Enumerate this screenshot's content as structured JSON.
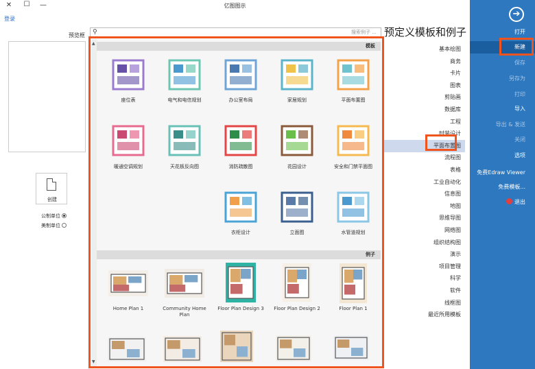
{
  "window": {
    "title": "亿图图示",
    "close": "✕",
    "minimize": "—",
    "maximize": "☐",
    "login": "登录"
  },
  "menu": {
    "back": "➔",
    "items": [
      {
        "label": "打开",
        "state": "normal"
      },
      {
        "label": "新建",
        "state": "selected"
      },
      {
        "label": "保存",
        "state": "dim"
      },
      {
        "label": "另存为",
        "state": "dim"
      },
      {
        "label": "打印",
        "state": "dim"
      },
      {
        "label": "导入",
        "state": "normal"
      },
      {
        "label": "导出 & 发送",
        "state": "dim"
      },
      {
        "label": "关闭",
        "state": "dim"
      },
      {
        "label": "选项",
        "state": "normal"
      },
      {
        "label": "免费Edraw Viewer",
        "state": "normal"
      },
      {
        "label": "免费模板...",
        "state": "normal"
      },
      {
        "label": "退出",
        "state": "normal"
      }
    ]
  },
  "categories": {
    "title": "预定义模板和例子",
    "items": [
      "基本绘图",
      "商务",
      "卡片",
      "图表",
      "剪贴画",
      "数据库",
      "工程",
      "时装设计",
      "平面布置图",
      "流程图",
      "表格",
      "工业自动化",
      "信息图",
      "地图",
      "思维导图",
      "网络图",
      "组织结构图",
      "演示",
      "项目管理",
      "科学",
      "软件",
      "线框图",
      "最近所用模板"
    ],
    "selected_index": 8
  },
  "search": {
    "placeholder": "搜索例子 ..."
  },
  "templates": {
    "header": "模板",
    "items": [
      "平面布置图",
      "家居规划",
      "办公室布局",
      "电气和电信规划",
      "座位表",
      "安全和门禁平面图",
      "花园设计",
      "消防疏散图",
      "天花板反向图",
      "暖通空调规划",
      "水管道规划",
      "立面图",
      "衣柜设计"
    ]
  },
  "examples": {
    "header": "例子",
    "items": [
      "Floor Plan 1",
      "Floor Plan Design 2",
      "Floor Plan Design 3",
      "Community Home Plan",
      "Home Plan 1"
    ]
  },
  "preview": {
    "label": "预览框",
    "new_button": "创建",
    "units_metric": "公制单位",
    "units_imperial": "美制单位",
    "selected_unit": "公制单位"
  },
  "colors": {
    "menu_bg": "#2e78bf",
    "menu_selected": "#1b5ea0",
    "highlight": "#f0541e",
    "category_selected": "#cfd9ee"
  }
}
